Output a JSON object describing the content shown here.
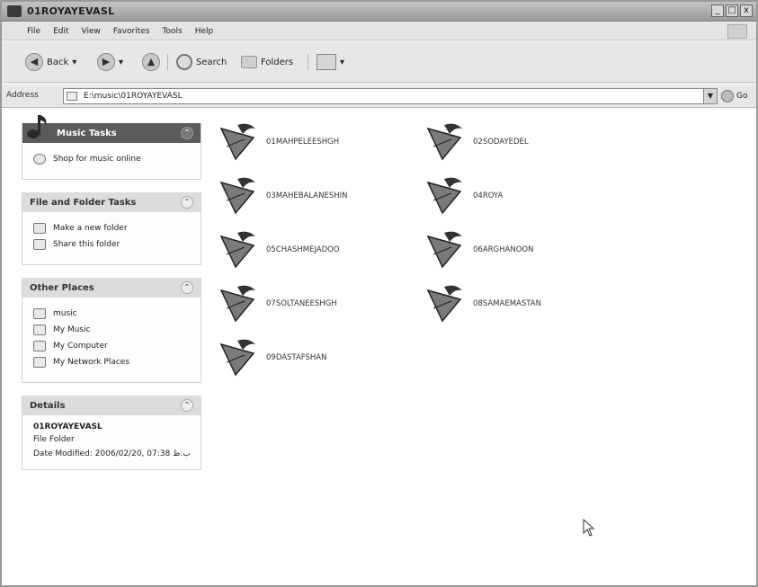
{
  "window": {
    "title": "01ROYAYEVASL",
    "controls": [
      "_",
      "□",
      "x"
    ]
  },
  "menu": [
    "File",
    "Edit",
    "View",
    "Favorites",
    "Tools",
    "Help"
  ],
  "toolbar": {
    "back": "Back",
    "search": "Search",
    "folders": "Folders"
  },
  "address": {
    "label": "Address",
    "value": "E:\\music\\01ROYAYEVASL",
    "go": "Go"
  },
  "sidebar": {
    "music_tasks": {
      "title": "Music Tasks",
      "items": [
        "Shop for music online"
      ]
    },
    "file_folder_tasks": {
      "title": "File and Folder Tasks",
      "items": [
        "Make a new folder",
        "Share this folder"
      ]
    },
    "other_places": {
      "title": "Other Places",
      "items": [
        "music",
        "My Music",
        "My Computer",
        "My Network Places"
      ]
    },
    "details": {
      "title": "Details",
      "name": "01ROYAYEVASL",
      "type": "File Folder",
      "modified": "Date Modified: 2006/02/20, 07:38 ب.ظ"
    }
  },
  "files": [
    "01MAHPELEESHGH",
    "02SODAYEDEL",
    "03MAHEBALANESHIN",
    "04ROYA",
    "05CHASHMEJADOO",
    "06ARGHANOON",
    "07SOLTANEESHGH",
    "08SAMAEMASTAN",
    "09DASTAFSHAN"
  ],
  "colors": {
    "panel_header_dark": "#5b5b5b",
    "panel_header_light": "#dcdcdc",
    "content_bg": "#ffffff"
  }
}
